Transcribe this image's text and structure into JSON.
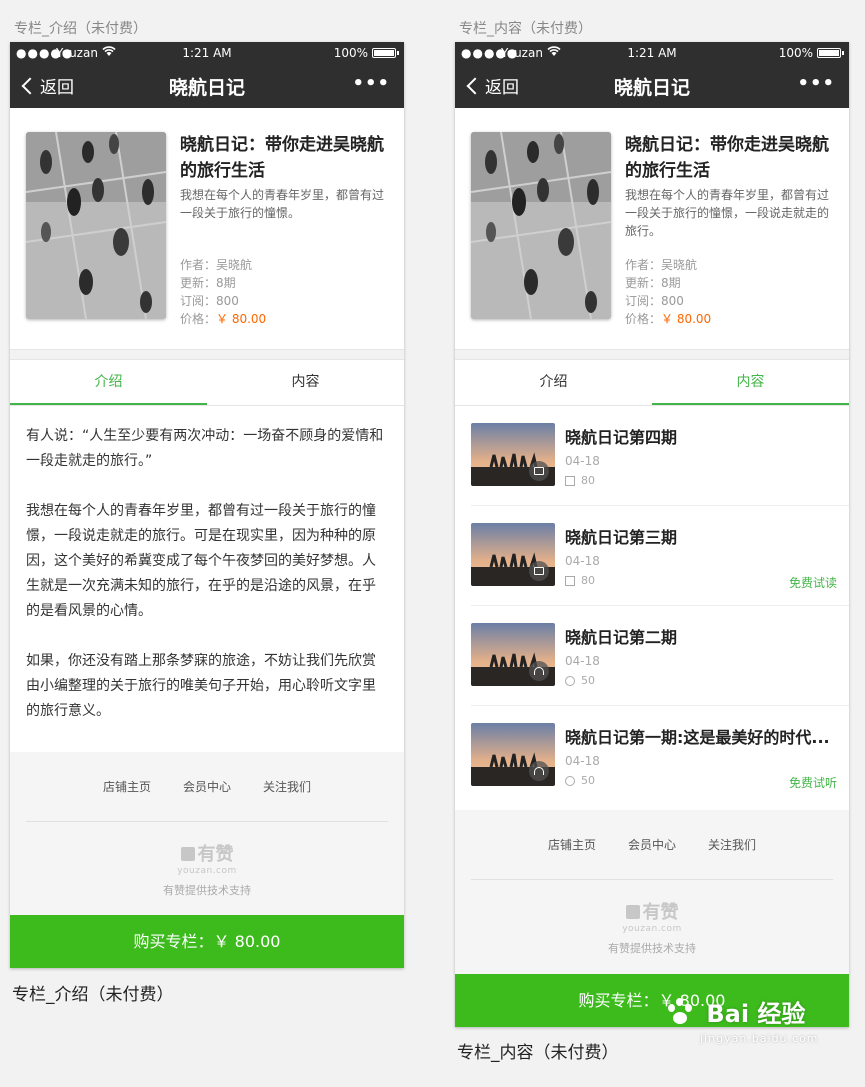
{
  "captions": {
    "left_top": "专栏_介绍（未付费）",
    "right_top": "专栏_内容（未付费）",
    "left_bottom": "专栏_介绍（未付费）",
    "right_bottom": "专栏_内容（未付费）"
  },
  "statusbar": {
    "signal": "●●●●●",
    "carrier": "Youzan",
    "time": "1:21 AM",
    "battery": "100%"
  },
  "navbar": {
    "back_label": "返回",
    "title": "晓航日记",
    "more": "•••"
  },
  "column": {
    "title": "晓航日记：带你走进吴晓航的旅行生活",
    "desc": "我想在每个人的青春年岁里，都曾有过一段关于旅行的憧憬。",
    "desc_full": "我想在每个人的青春年岁里，都曾有过一段关于旅行的憧憬，一段说走就走的旅行。",
    "author": "作者：吴晓航",
    "updates": "更新：8期",
    "subs": "订阅：800",
    "price_label": "价格：",
    "price": "￥ 80.00"
  },
  "tabs": {
    "intro": "介绍",
    "content": "内容"
  },
  "intro_text": {
    "p1": "有人说：“人生至少要有两次冲动：一场奋不顾身的爱情和一段走就走的旅行。”",
    "p2": "我想在每个人的青春年岁里，都曾有过一段关于旅行的憧憬，一段说走就走的旅行。可是在现实里，因为种种的原因，这个美好的希冀变成了每个午夜梦回的美好梦想。人生就是一次充满未知的旅行，在乎的是沿途的风景，在乎的是看风景的心情。",
    "p3": "如果，你还没有踏上那条梦寐的旅途，不妨让我们先欣赏由小编整理的关于旅行的唯美句子开始，用心聆听文字里的旅行意义。"
  },
  "episodes": [
    {
      "title": "晓航日记第四期",
      "date": "04-18",
      "count": "80",
      "free": "",
      "type": "doc-icon"
    },
    {
      "title": "晓航日记第三期",
      "date": "04-18",
      "count": "80",
      "free": "免费试读",
      "type": "doc-icon"
    },
    {
      "title": "晓航日记第二期",
      "date": "04-18",
      "count": "50",
      "free": "",
      "type": "headphone-icon"
    },
    {
      "title": "晓航日记第一期:这是最美好的时代...",
      "date": "04-18",
      "count": "50",
      "free": "免费试听",
      "type": "headphone-icon"
    }
  ],
  "footer": {
    "shop_home": "店铺主页",
    "member_center": "会员中心",
    "follow_us": "关注我们",
    "brand": "有赞",
    "domain": "youzan.com",
    "support": "有赞提供技术支持"
  },
  "buy": {
    "label": "购买专栏：￥ 80.00"
  },
  "watermark": {
    "text": "Bai 经验",
    "sub": "jingyan.baidu.com"
  },
  "colors": {
    "accent_green": "#44b549",
    "buy_green": "#3dbb1d",
    "price_orange": "#ff6600",
    "nav_dark": "#2f2f2f"
  }
}
